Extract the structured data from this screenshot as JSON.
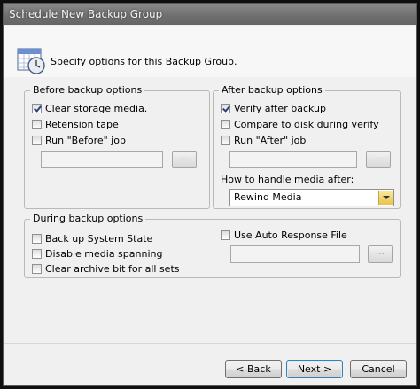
{
  "window": {
    "title": "Schedule New Backup Group"
  },
  "header": {
    "text": "Specify options for this Backup Group."
  },
  "before": {
    "legend": "Before backup options",
    "clear_media": "Clear storage media.",
    "retension": "Retension tape",
    "run_before": "Run \"Before\" job",
    "browse": "..."
  },
  "after": {
    "legend": "After backup options",
    "verify": "Verify after backup",
    "compare": "Compare to disk during verify",
    "run_after": "Run \"After\" job",
    "browse": "...",
    "media_label": "How to handle media after:",
    "media_value": "Rewind Media"
  },
  "during": {
    "legend": "During backup options",
    "system_state": "Back up System State",
    "disable_spanning": "Disable media spanning",
    "clear_archive": "Clear archive bit for all sets",
    "auto_response": "Use Auto Response File",
    "browse": "..."
  },
  "buttons": {
    "back": "< Back",
    "next": "Next >",
    "cancel": "Cancel"
  }
}
